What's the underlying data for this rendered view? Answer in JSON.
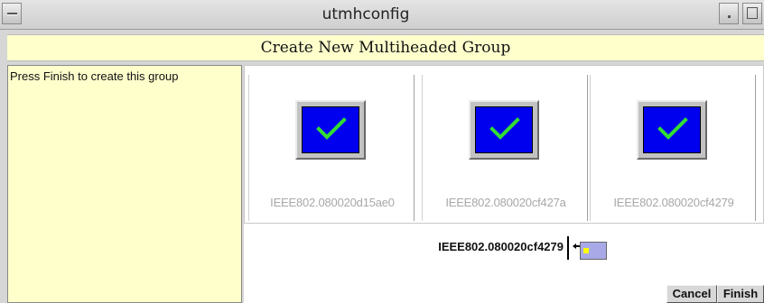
{
  "window": {
    "title": "utmhconfig"
  },
  "dialog": {
    "heading": "Create New Multiheaded Group",
    "instruction": "Press Finish to create this group"
  },
  "monitors": [
    {
      "label": "IEEE802.080020d15ae0",
      "screen_color": "#0000ee",
      "check_color": "#33dd33"
    },
    {
      "label": "IEEE802.080020cf427a",
      "screen_color": "#0000ee",
      "check_color": "#33dd33"
    },
    {
      "label": "IEEE802.080020cf4279",
      "screen_color": "#0000ee",
      "check_color": "#33dd33"
    }
  ],
  "selection": {
    "label": "IEEE802.080020cf4279"
  },
  "buttons": {
    "cancel": "Cancel",
    "finish": "Finish"
  },
  "colors": {
    "panel_background": "#ffffcc",
    "content_background": "#ffffff",
    "label_gray": "#a8a8a8"
  },
  "icons": {
    "window_menu": "window-menu-icon",
    "minimize": "minimize-icon",
    "maximize": "maximize-icon",
    "check": "checkmark-icon",
    "arrow": "left-arrow-icon",
    "mini_monitor": "mini-monitor-icon"
  }
}
